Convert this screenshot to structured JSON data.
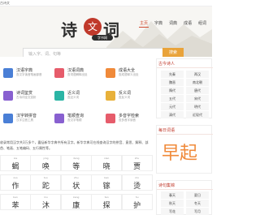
{
  "topbar": {
    "text": "古诗文"
  },
  "nav": [
    "主页",
    "字典",
    "词典",
    "成语",
    "组词"
  ],
  "logo": {
    "c1": "诗",
    "c2": "文",
    "c3": "词",
    "pin": "字书网"
  },
  "search": {
    "placeholder": "输入字、词、句等",
    "button": "搜索"
  },
  "tools": [
    {
      "title": "汉语字典",
      "sub": "查汉字读音笔画部首",
      "color": "blue"
    },
    {
      "title": "汉语词典",
      "sub": "查词语解释出处",
      "color": "pink"
    },
    {
      "title": "成语大全",
      "sub": "查成语释义出处",
      "color": "orange"
    },
    {
      "title": "诗词鉴赏",
      "sub": "古诗词全文赏析",
      "color": "purple"
    },
    {
      "title": "近义词",
      "sub": "查近义词",
      "color": "teal"
    },
    {
      "title": "反义词",
      "sub": "查反义词",
      "color": "gold"
    },
    {
      "title": "汉字转拼音",
      "sub": "汉字注音工具",
      "color": "blue"
    },
    {
      "title": "笔顺查询",
      "sub": "查汉字笔顺",
      "color": "purple"
    },
    {
      "title": "多音字检索",
      "sub": "查多音字读音",
      "color": "pink"
    }
  ],
  "intro": "收录常用汉字共3万多个，囊括新华字典中所有汉字。新华字典可在线查询汉字的拼音、意思、解释、部首、笔画、五笔编码、五行属性等。",
  "chars": [
    {
      "py": "xie",
      "zi": "蝎"
    },
    {
      "py": "ying",
      "zi": "唤"
    },
    {
      "py": "deng",
      "zi": "等"
    },
    {
      "py": "xiao",
      "zi": "晓"
    },
    {
      "py": "zhu",
      "zi": "贾"
    },
    {
      "py": "zuo",
      "zi": "作"
    },
    {
      "py": "tuo",
      "zi": "跎"
    },
    {
      "py": "zhu",
      "zi": "状"
    },
    {
      "py": "ban",
      "zi": "镓"
    },
    {
      "py": "mo",
      "zi": "烫"
    },
    {
      "py": "ben",
      "zi": "苯"
    },
    {
      "py": "mu",
      "zi": "沐"
    },
    {
      "py": "kang",
      "zi": "康"
    },
    {
      "py": "tan",
      "zi": "探"
    },
    {
      "py": "hu",
      "zi": "护"
    }
  ],
  "side": {
    "authors_title": "古今诗人",
    "authors": [
      "先秦",
      "两汉",
      "魏晋",
      "南北朝",
      "隋代",
      "唐代",
      "五代",
      "宋代",
      "元代",
      "明代",
      "清代",
      "近现代"
    ],
    "daily_title": "每日词语",
    "daily_word": "早起",
    "poem_title": "诗句集锦",
    "poems": [
      "春天",
      "夏日",
      "秋天",
      "冬天",
      "写花",
      "写月"
    ]
  },
  "colors": {
    "accent": "#c0392b",
    "button": "#e9a33a",
    "nav_active": "#d04a2f"
  }
}
